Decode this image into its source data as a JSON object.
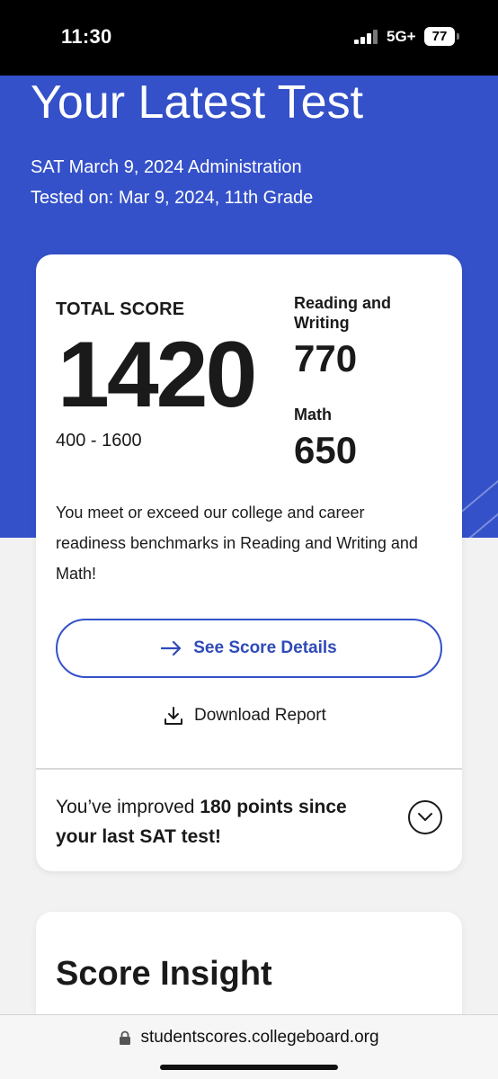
{
  "status_bar": {
    "time": "11:30",
    "network": "5G+",
    "battery": "77"
  },
  "hero": {
    "title": "Your Latest Test",
    "administration": "SAT March 9, 2024 Administration",
    "tested_on": "Tested on: Mar 9, 2024, 11th Grade",
    "background_color": "#3451c9"
  },
  "score_card": {
    "total_label": "TOTAL SCORE",
    "total_value": "1420",
    "total_range": "400 - 1600",
    "sections": [
      {
        "label": "Reading and Writing",
        "value": "770"
      },
      {
        "label": "Math",
        "value": "650"
      }
    ],
    "benchmark_text": "You meet or exceed our college and career readiness benchmarks in Reading and Writing and Math!",
    "details_button_label": "See Score Details",
    "download_label": "Download Report",
    "improvement_prefix": "You’ve improved ",
    "improvement_bold": "180 points since your last SAT test!",
    "accent_color": "#2f4ab8"
  },
  "insight": {
    "title": "Score Insight"
  },
  "browser": {
    "url": "studentscores.collegeboard.org"
  },
  "icons": {
    "arrow": "arrow-right-icon",
    "download": "download-icon",
    "chevron": "chevron-down-icon",
    "lock": "lock-icon"
  }
}
